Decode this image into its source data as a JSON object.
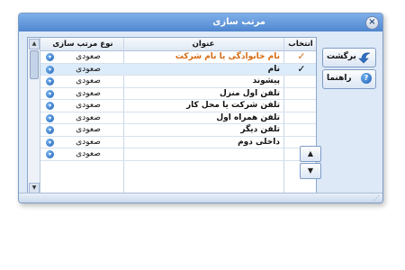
{
  "window": {
    "title": "مرتب سازی",
    "close_glyph": "×"
  },
  "grid": {
    "columns": {
      "select": "انتخاب",
      "title": "عنوان",
      "sort_type": "نوع مرتب سازی"
    },
    "rows": [
      {
        "title": "نام خانوادگی یا نام شرکت",
        "sort": "صعودی",
        "checked": "✓"
      },
      {
        "title": "نام",
        "sort": "صعودی",
        "checked": "✓"
      },
      {
        "title": "پیشوند",
        "sort": "صعودی",
        "checked": ""
      },
      {
        "title": "تلفن اول منزل",
        "sort": "صعودی",
        "checked": ""
      },
      {
        "title": "تلفن شرکت یا محل کار",
        "sort": "صعودی",
        "checked": ""
      },
      {
        "title": "تلفن همراه اول",
        "sort": "صعودی",
        "checked": ""
      },
      {
        "title": "تلفن دیگر",
        "sort": "صعودی",
        "checked": ""
      },
      {
        "title": "داخلی دوم",
        "sort": "صعودی",
        "checked": ""
      },
      {
        "title": "",
        "sort": "صعودی",
        "checked": ""
      }
    ]
  },
  "buttons": {
    "back": "برگشت",
    "help": "راهنما",
    "help_glyph": "?",
    "move_up_glyph": "▲",
    "move_down_glyph": "▼"
  },
  "icons": {
    "sort_glyph": "▾",
    "scroll_up": "▲",
    "scroll_down": "▼",
    "grip": "⋰"
  },
  "colors": {
    "titlebar": "#4f86cf",
    "highlight_text": "#d56a12",
    "selected_row": "#dcecfb"
  }
}
